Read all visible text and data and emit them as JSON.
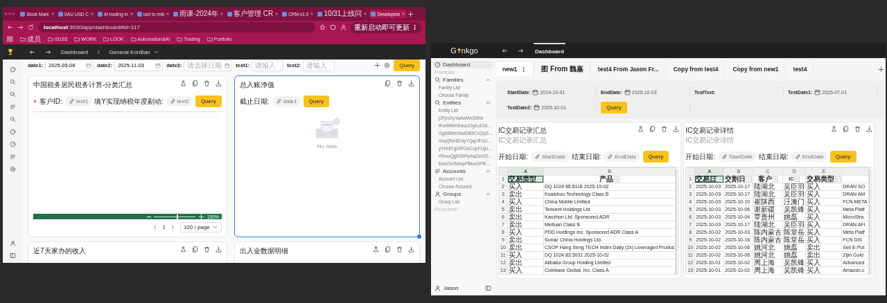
{
  "left_window": {
    "browser_tabs": [
      {
        "title": "Stock Mark",
        "selected": false
      },
      {
        "title": "XAU USD C",
        "selected": false
      },
      {
        "title": "AI trading in",
        "selected": false
      },
      {
        "title": "usd to rmb",
        "selected": false
      },
      {
        "title": "雨课-2024年",
        "selected": false
      },
      {
        "title": "客户管理 CR",
        "selected": false
      },
      {
        "title": "CRM-v1.0",
        "selected": false
      },
      {
        "title": "10/31上线问",
        "selected": false
      },
      {
        "title": "Developme",
        "selected": true
      }
    ],
    "address": "**localhost**:3030/app/dashboard#id=117",
    "update_button": "重新启动即可更新",
    "bookmarks": [
      "成员",
      "SI165",
      "WORK",
      "LOOK",
      "Automation&AI",
      "Trading",
      "Portfolio"
    ],
    "breadcrumb": {
      "root": "Dashboard",
      "separator": "/",
      "current": "General KonBan"
    },
    "filters": [
      {
        "label": "date1:",
        "kind": "date",
        "value": "2025-05-08"
      },
      {
        "label": "date2:",
        "kind": "date",
        "value": "2025-11-03"
      },
      {
        "label": "date3:",
        "kind": "date",
        "placeholder": "请选择日期"
      },
      {
        "label": "text1:",
        "kind": "text",
        "placeholder": "请输入"
      },
      {
        "label": "text2:",
        "kind": "text",
        "placeholder": "请输入"
      }
    ],
    "query_button": "Query",
    "cards": [
      {
        "title": "中国税务居民税务计算-分类汇总",
        "selected": false,
        "kind": "sheet",
        "params": [
          {
            "label": "客户ID:",
            "required": true,
            "value": "text1"
          },
          {
            "label": "填Y实现纳税年度剔动:",
            "required": false,
            "value": "text2"
          }
        ],
        "query": "Query",
        "zoom": {
          "level": 0.55,
          "reading": "100%"
        },
        "page": "1",
        "page_size": "100 / page"
      },
      {
        "title": "总入账净值",
        "selected": true,
        "kind": "empty",
        "params": [
          {
            "label": "截止日期:",
            "required": false,
            "value": "date1"
          }
        ],
        "query": "Query",
        "empty_text": "No data"
      },
      {
        "title": "近7天家办的收入",
        "selected": false,
        "kind": "collapsed"
      },
      {
        "title": "出入金数据明细",
        "selected": false,
        "kind": "collapsed"
      }
    ]
  },
  "right_window": {
    "logo": [
      "G",
      "nkgo"
    ],
    "nav_tabs": [
      {
        "label": "Dashboard",
        "selected": true
      }
    ],
    "sidebar": [
      {
        "kind": "item",
        "label": "Dashboard",
        "selected": true
      },
      {
        "kind": "section",
        "label": "Portfolio"
      },
      {
        "kind": "group",
        "label": "Families",
        "expanded": true,
        "children": [
          {
            "kind": "item",
            "label": "Family List",
            "selected": false
          },
          {
            "kind": "item",
            "label": "Choose Family",
            "selected": false
          }
        ]
      },
      {
        "kind": "group",
        "label": "Entities",
        "expanded": true,
        "children": [
          {
            "kind": "item",
            "label": "Entity List",
            "selected": false
          },
          {
            "kind": "item",
            "label": "jJPpxXyYaAwWxSWw",
            "selected": false
          },
          {
            "kind": "item",
            "label": "fFwWMmEauUGgILdOd...",
            "selected": false
          },
          {
            "kind": "item",
            "label": "GgbBMmSsdDBbCcQqS...",
            "selected": false
          },
          {
            "kind": "item",
            "label": "VvqQNnlIDdyYQqLfFuU...",
            "selected": false
          },
          {
            "kind": "item",
            "label": "yYhHtTgGfFOoCopFUjU...",
            "selected": false
          },
          {
            "kind": "item",
            "label": "rRvvoQgE0bPpAaZzxX0...",
            "selected": false
          },
          {
            "kind": "item",
            "label": "EesOvVMmpPBboOFfK...",
            "selected": false
          }
        ]
      },
      {
        "kind": "group",
        "label": "Accounts",
        "expanded": true,
        "children": [
          {
            "kind": "item",
            "label": "Account List",
            "selected": false
          },
          {
            "kind": "item",
            "label": "Choose Account",
            "selected": false
          }
        ]
      },
      {
        "kind": "group",
        "label": "Groups",
        "expanded": true,
        "children": [
          {
            "kind": "item",
            "label": "Group List",
            "selected": false
          }
        ]
      },
      {
        "kind": "section",
        "label": "Research"
      }
    ],
    "user": "Jason",
    "tabs": [
      {
        "label": "new1",
        "selected": true
      },
      {
        "label": "图 From 魏嘉",
        "selected": false
      },
      {
        "label": "test4 From Jason Fr...",
        "selected": false
      },
      {
        "label": "Copy from test4",
        "selected": false
      },
      {
        "label": "Copy from new1",
        "selected": false
      },
      {
        "label": "test4",
        "selected": false
      }
    ],
    "filters": [
      {
        "label": "StartDate:",
        "kind": "date",
        "value": "2024-10-01"
      },
      {
        "label": "EndDate:",
        "kind": "date",
        "value": "2025-10-03"
      },
      {
        "label": "TestText:",
        "kind": "text"
      },
      {
        "label": "TestDate1:",
        "kind": "date",
        "value": "2025-07-01"
      },
      {
        "label": "TestDate2:",
        "kind": "date",
        "value": "2025-10-01"
      }
    ],
    "query_button": "Query",
    "cards": [
      {
        "title": "IC交易记录汇总",
        "subtitle": "IC交易记录汇总",
        "params": [
          {
            "label": "开始日期:",
            "value": "StartDate"
          },
          {
            "label": "结束日期:",
            "value": "EndDate"
          }
        ],
        "query": "Query",
        "sheet": {
          "columns": [
            {
              "label": "A",
              "selected": true
            },
            {
              "label": "B",
              "selected": false
            }
          ],
          "header": {
            "n": "1",
            "cells": [
              {
                "text": "交易类型",
                "selected": true
              },
              {
                "text": "产品",
                "selected": false
              }
            ]
          },
          "rows": [
            {
              "n": "2",
              "cells": [
                "买入",
                "DQ 1024 85.8118 2025-10-02"
              ]
            },
            {
              "n": "3",
              "cells": [
                "卖出",
                "Kuaishou Technology Class B"
              ]
            },
            {
              "n": "4",
              "cells": [
                "买入",
                "China Mobile Limited"
              ]
            },
            {
              "n": "5",
              "cells": [
                "卖出",
                "Tencent Holdings Ltd"
              ]
            },
            {
              "n": "6",
              "cells": [
                "卖出",
                "Kanzhun Ltd. Sponsored ADR"
              ]
            },
            {
              "n": "7",
              "cells": [
                "卖出",
                "Meituan Class B"
              ]
            },
            {
              "n": "8",
              "cells": [
                "买入",
                "PDD Holdings Inc. Sponsored ADR Class A"
              ]
            },
            {
              "n": "9",
              "cells": [
                "卖出",
                "Sunac China Holdings Ltd."
              ]
            },
            {
              "n": "10",
              "cells": [
                "卖出",
                "CSOP Hang Seng TECH Index Daily (2x) Leveraged Produc"
              ]
            },
            {
              "n": "11",
              "cells": [
                "买入",
                "DQ 1024 83.5031 2025-10-02"
              ]
            },
            {
              "n": "12",
              "cells": [
                "卖出",
                "Alibaba Group Holding Limited"
              ]
            },
            {
              "n": "13",
              "cells": [
                "买入",
                "Coinbase Global, Inc. Class A"
              ]
            }
          ]
        }
      },
      {
        "title": "IC交易记录详情",
        "subtitle": "IC交易记录详情",
        "params": [
          {
            "label": "开始日期:",
            "value": "StartDate"
          },
          {
            "label": "结束日期:",
            "value": "EndDate"
          }
        ],
        "query": "Query",
        "sheet": {
          "columns": [
            {
              "label": "A",
              "selected": true
            },
            {
              "label": "B",
              "selected": false
            },
            {
              "label": "C",
              "selected": false
            },
            {
              "label": "D",
              "selected": false
            },
            {
              "label": "E",
              "selected": false
            }
          ],
          "header": {
            "n": "1",
            "cells": [
              {
                "text": "交易日",
                "selected": true
              },
              {
                "text": "交割日",
                "selected": false
              },
              {
                "text": "客户",
                "selected": false
              },
              {
                "text": "IC",
                "selected": false
              },
              {
                "text": "交易类型",
                "selected": false
              }
            ]
          },
          "rows": [
            {
              "n": "2",
              "cells": [
                "2025-10-03",
                "2025-10-17",
                "陆湖北",
                "吴臣羽",
                "买入",
                "DRAN SO"
              ]
            },
            {
              "n": "3",
              "cells": [
                "2025-10-03",
                "2025-10-17",
                "陆湖北",
                "吴臣羽",
                "买入",
                "DRAN AM"
              ]
            },
            {
              "n": "4",
              "cells": [
                "2025-10-03",
                "2025-10-10",
                "崔陕西",
                "汪澳门",
                "买入",
                "FCN META"
              ]
            },
            {
              "n": "5",
              "cells": [
                "2025-10-03",
                "2025-10-06",
                "谢新疆",
                "吴凯锋",
                "买入",
                "Meta Platf"
              ]
            },
            {
              "n": "6",
              "cells": [
                "2025-10-03",
                "2025-10-04",
                "覃贵州",
                "姚磊",
                "买入",
                "MicroStra"
              ]
            },
            {
              "n": "7",
              "cells": [
                "2025-10-03",
                "2025-10-17",
                "陆湖北",
                "吴臣羽",
                "买入",
                "DRAN AFI"
              ]
            },
            {
              "n": "8",
              "cells": [
                "2025-10-02",
                "2025-10-03",
                "陈内蒙古",
                "陈堂岳",
                "买入",
                "Meta Platf"
              ]
            },
            {
              "n": "9",
              "cells": [
                "2025-10-02",
                "2025-10-16",
                "陈内蒙古",
                "陈堂岳",
                "买入",
                "FCN DIS"
              ]
            },
            {
              "n": "10",
              "cells": [
                "2025-10-02",
                "2025-10-06",
                "姚河北",
                "姚磊",
                "卖出",
                "Sell E-Put"
              ]
            },
            {
              "n": "11",
              "cells": [
                "2025-10-02",
                "2025-10-06",
                "姚河北",
                "姚磊",
                "卖出",
                "Zijin Gold"
              ]
            },
            {
              "n": "12",
              "cells": [
                "2025-10-01",
                "2025-10-02",
                "周上海",
                "吴凯锋",
                "买入",
                "Advanced"
              ]
            },
            {
              "n": "13",
              "cells": [
                "2025-10-01",
                "2025-10-02",
                "周上海",
                "吴凯锋",
                "买入",
                "Amazon.c"
              ]
            }
          ]
        }
      }
    ]
  }
}
